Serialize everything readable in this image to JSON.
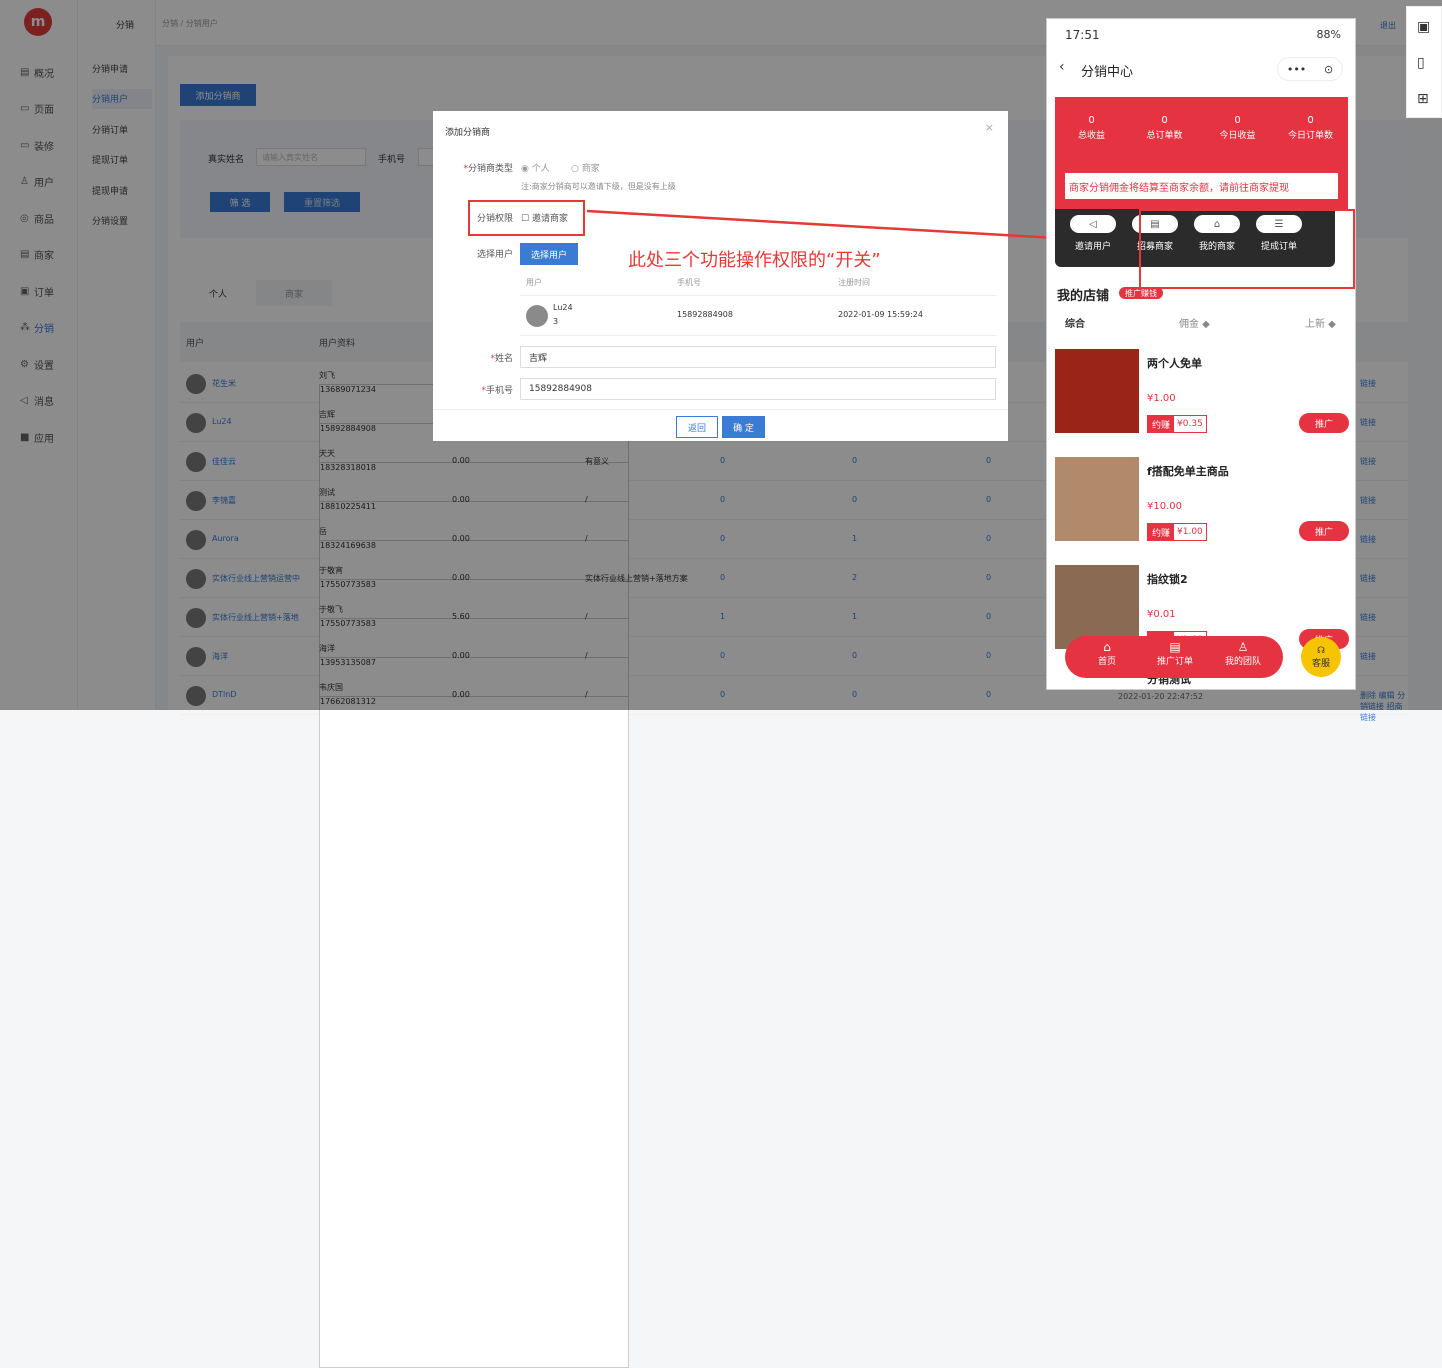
{
  "nav": {
    "items": [
      {
        "icon": "overview-icon",
        "glyph": "▤",
        "label": "概况"
      },
      {
        "icon": "page-icon",
        "glyph": "▭",
        "label": "页面"
      },
      {
        "icon": "decor-icon",
        "glyph": "▭",
        "label": "装修"
      },
      {
        "icon": "user-icon",
        "glyph": "♙",
        "label": "用户"
      },
      {
        "icon": "goods-icon",
        "glyph": "◎",
        "label": "商品"
      },
      {
        "icon": "merchant-icon",
        "glyph": "▤",
        "label": "商家"
      },
      {
        "icon": "order-icon",
        "glyph": "▣",
        "label": "订单"
      },
      {
        "icon": "distribution-icon",
        "glyph": "⁂",
        "label": "分销"
      },
      {
        "icon": "settings-icon",
        "glyph": "⚙",
        "label": "设置"
      },
      {
        "icon": "message-icon",
        "glyph": "◁",
        "label": "消息"
      },
      {
        "icon": "apps-icon",
        "glyph": "■",
        "label": "应用"
      }
    ],
    "active": "分销"
  },
  "subnav": {
    "title": "分销",
    "items": [
      "分销申请",
      "分销用户",
      "分销订单",
      "提现订单",
      "提现申请",
      "分销设置"
    ],
    "active": "分销用户"
  },
  "breadcrumb": "分销 / 分销用户",
  "logout": "退出",
  "toolbar": {
    "add_label": "添加分销商"
  },
  "filter": {
    "name_label": "真实姓名",
    "name_placeholder": "请输入真实姓名",
    "phone_label": "手机号",
    "filter_button": "筛 选",
    "reset_button": "重置筛选"
  },
  "tabs": [
    "个人",
    "商家"
  ],
  "table": {
    "headers": [
      "用户",
      "用户资料"
    ],
    "rows": [
      {
        "name": "花生米",
        "alias": "刘飞",
        "phone": "13689071234",
        "commission": "",
        "remark": "",
        "c1": "",
        "c2": "",
        "c3": "",
        "ops": "链接"
      },
      {
        "name": "Lu24",
        "alias": "吉辉",
        "phone": "15892884908",
        "commission": "",
        "remark": "",
        "c1": "",
        "c2": "",
        "c3": "",
        "ops": "链接"
      },
      {
        "name": "佳佳云",
        "alias": "天天",
        "phone": "18328318018",
        "commission": "0.00",
        "remark": "有意义",
        "c1": "0",
        "c2": "0",
        "c3": "0",
        "ops": "链接"
      },
      {
        "name": "李锦嘉",
        "alias": "测试",
        "phone": "18810225411",
        "commission": "0.00",
        "remark": "/",
        "c1": "0",
        "c2": "0",
        "c3": "0",
        "ops": "链接"
      },
      {
        "name": "Aurora",
        "alias": "岳",
        "phone": "18324169638",
        "commission": "0.00",
        "remark": "/",
        "c1": "0",
        "c2": "1",
        "c3": "0",
        "ops": "链接"
      },
      {
        "name": "实体行业线上营销运营中",
        "alias": "于敬宵",
        "phone": "17550773583",
        "commission": "0.00",
        "remark": "实体行业线上营销+落地方案",
        "c1": "0",
        "c2": "2",
        "c3": "0",
        "ops": "链接"
      },
      {
        "name": "实体行业线上营销+落地",
        "alias": "于敬飞",
        "phone": "17550773583",
        "commission": "5.60",
        "remark": "/",
        "c1": "1",
        "c2": "1",
        "c3": "0",
        "ops": "链接"
      },
      {
        "name": "海洋",
        "alias": "海洋",
        "phone": "13953135087",
        "commission": "0.00",
        "remark": "/",
        "c1": "0",
        "c2": "0",
        "c3": "0",
        "ops": "链接"
      },
      {
        "name": "DTlnD",
        "alias": "韦庆国",
        "phone": "17662081312",
        "commission": "0.00",
        "remark": "/",
        "c1": "0",
        "c2": "0",
        "c3": "0",
        "ops": "删除 编辑 分销链接 招商链接"
      }
    ],
    "last_time": "2022-01-20 22:47:52"
  },
  "modal": {
    "title": "添加分销商",
    "close": "×",
    "type_label": "分销商类型",
    "type_options": [
      "个人",
      "商家"
    ],
    "type_note": "注:商家分销商可以邀请下级，但是没有上级",
    "perm_label": "分销权限",
    "perm_option": "邀请商家",
    "select_label": "选择用户",
    "select_button": "选择用户",
    "cols": [
      "用户",
      "手机号",
      "注册时间"
    ],
    "selected": {
      "name": "Lu24",
      "sub": "3",
      "phone": "15892884908",
      "time": "2022-01-09 15:59:24"
    },
    "name_label": "姓名",
    "name_value": "吉辉",
    "phone_label": "手机号",
    "phone_value": "15892884908",
    "back_button": "返回",
    "ok_button": "确 定"
  },
  "annotation": "此处三个功能操作权限的“开关”",
  "phone": {
    "time": "17:51",
    "status_right": "88%",
    "title": "分销中心",
    "capsule_more": "•••",
    "capsule_close": "⊙",
    "stats": [
      {
        "value": "0",
        "label": "总收益"
      },
      {
        "value": "0",
        "label": "总订单数"
      },
      {
        "value": "0",
        "label": "今日收益"
      },
      {
        "value": "0",
        "label": "今日订单数"
      }
    ],
    "notice": "商家分销佣金将结算至商家余额，请前往商家提现",
    "funcs": [
      {
        "icon": "send-icon",
        "glyph": "◁",
        "label": "邀请用户"
      },
      {
        "icon": "shop-icon",
        "glyph": "▤",
        "label": "招募商家"
      },
      {
        "icon": "home-icon",
        "glyph": "⌂",
        "label": "我的商家"
      },
      {
        "icon": "list-icon",
        "glyph": "☰",
        "label": "提成订单"
      }
    ],
    "store_title": "我的店铺",
    "store_tag": "推广赚钱",
    "sort": [
      "综合",
      "佣金 ◆",
      "上新 ◆"
    ],
    "goods": [
      {
        "name": "两个人免单",
        "price": "¥1.00",
        "earn_label": "约赚",
        "earn": "¥0.35",
        "btn": "推广"
      },
      {
        "name": "f搭配免单主商品",
        "price": "¥10.00",
        "earn_label": "约赚",
        "earn": "¥1.00",
        "btn": "推广"
      },
      {
        "name": "指纹锁2",
        "price": "¥0.01",
        "earn_label": "约赚",
        "earn": "¥1.00",
        "btn": "推广"
      }
    ],
    "partial_good": "分销测试",
    "tabbar": [
      {
        "icon": "home-icon",
        "glyph": "⌂",
        "label": "首页"
      },
      {
        "icon": "order-icon",
        "glyph": "▤",
        "label": "推广订单"
      },
      {
        "icon": "team-icon",
        "glyph": "♙",
        "label": "我的团队"
      }
    ],
    "service": "客服"
  },
  "colors": {
    "accent": "#3a7bd5",
    "brand_red": "#e53342",
    "annotation_red": "#e53935"
  }
}
